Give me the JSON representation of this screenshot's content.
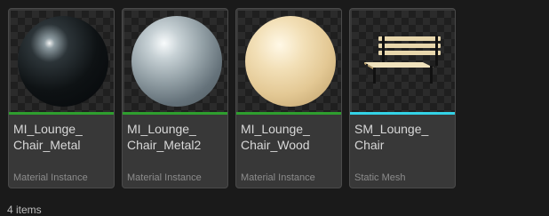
{
  "assets": [
    {
      "name": "MI_Lounge_\nChair_Metal",
      "line1": "MI_Lounge_",
      "line2": "Chair_Metal",
      "type": "Material Instance",
      "bar_color": "#2e9e2e",
      "thumbnail": "metal-sphere"
    },
    {
      "name": "MI_Lounge_\nChair_Metal2",
      "line1": "MI_Lounge_",
      "line2": "Chair_Metal2",
      "type": "Material Instance",
      "bar_color": "#2e9e2e",
      "thumbnail": "metal2-sphere"
    },
    {
      "name": "MI_Lounge_\nChair_Wood",
      "line1": "MI_Lounge_",
      "line2": "Chair_Wood",
      "type": "Material Instance",
      "bar_color": "#2e9e2e",
      "thumbnail": "wood-sphere"
    },
    {
      "name": "SM_Lounge_\nChair",
      "line1": "SM_Lounge_",
      "line2": "Chair",
      "type": "Static Mesh",
      "bar_color": "#33d2e6",
      "thumbnail": "bench-mesh"
    }
  ],
  "footer": {
    "item_count": "4 items"
  }
}
